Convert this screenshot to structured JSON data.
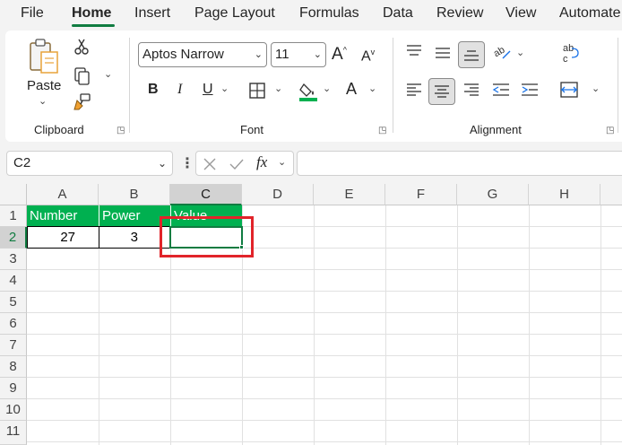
{
  "menu": {
    "tabs": [
      "File",
      "Home",
      "Insert",
      "Page Layout",
      "Formulas",
      "Data",
      "Review",
      "View",
      "Automate"
    ],
    "active": "Home"
  },
  "ribbon": {
    "clipboard": {
      "paste_label": "Paste",
      "group_label": "Clipboard"
    },
    "font": {
      "font_name": "Aptos Narrow",
      "font_size": "11",
      "group_label": "Font"
    },
    "alignment": {
      "group_label": "Alignment",
      "wrap_icon_text": "ab\nc"
    }
  },
  "formula_bar": {
    "name_box": "C2",
    "fx_label": "fx",
    "formula": ""
  },
  "sheet": {
    "columns": [
      "A",
      "B",
      "C",
      "D",
      "E",
      "F",
      "G",
      "H"
    ],
    "selected_column": "C",
    "rows": [
      "1",
      "2",
      "3",
      "4",
      "5",
      "6",
      "7",
      "8",
      "9",
      "10",
      "11"
    ],
    "selected_row": "2",
    "cells": {
      "A1": "Number",
      "B1": "Power",
      "C1": "Value",
      "A2": "27",
      "B2": "3",
      "C2": ""
    },
    "header_fill": "#00b050",
    "selection_color": "#107c41",
    "highlight_color": "#e1242a"
  }
}
